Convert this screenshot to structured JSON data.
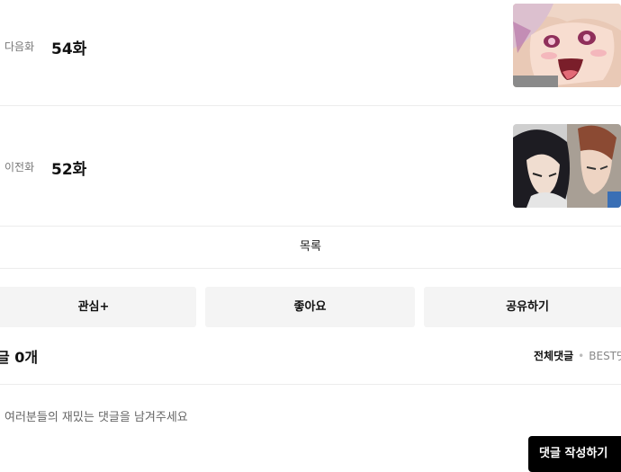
{
  "episodes": {
    "next": {
      "label": "다음화",
      "number": "54화"
    },
    "prev": {
      "label": "이전화",
      "number": "52화"
    }
  },
  "list_label": "목록",
  "actions": {
    "interest": "관심+",
    "like": "좋아요",
    "share": "공유하기"
  },
  "comments": {
    "count_label": "글 0개",
    "tab_all": "전체댓글",
    "tab_best": "BEST댓",
    "placeholder": "여러분들의 재밌는 댓글을 남겨주세요",
    "write_button": "댓글 작성하기"
  }
}
